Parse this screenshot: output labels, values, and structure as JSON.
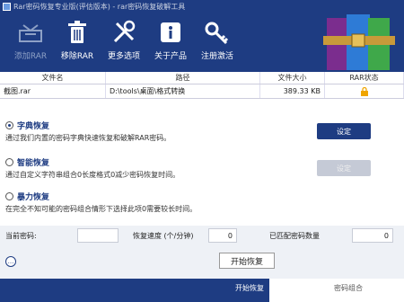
{
  "window": {
    "title": "Rar密码恢复专业版(评估版本) - rar密码恢复破解工具"
  },
  "toolbar": {
    "buttons": [
      {
        "label": "添加RAR",
        "icon": "add-archive-icon",
        "disabled": true
      },
      {
        "label": "移除RAR",
        "icon": "trash-icon"
      },
      {
        "label": "更多选项",
        "icon": "tools-icon"
      },
      {
        "label": "关于产品",
        "icon": "info-icon"
      },
      {
        "label": "注册激活",
        "icon": "key-icon"
      }
    ]
  },
  "table": {
    "headers": [
      "文件名",
      "路径",
      "文件大小",
      "RAR状态"
    ],
    "rows": [
      {
        "name": "截图.rar",
        "path": "D:\\tools\\桌面\\格式转换",
        "size": "389.33 KB",
        "status_icon": "lock-icon"
      }
    ]
  },
  "options": [
    {
      "label": "字典恢复",
      "desc": "通过我们内置的密码字典快速恢复和破解RAR密码。",
      "selected": true,
      "button": "设定",
      "button_enabled": true
    },
    {
      "label": "智能恢复",
      "desc": "通过自定义字符串组合0长度格式0减少密码恢复时间。",
      "selected": false,
      "button": "设定",
      "button_enabled": false
    },
    {
      "label": "暴力恢复",
      "desc": "在完全不知可能的密码组合情形下选择此项0需要较长时间。",
      "selected": false
    }
  ],
  "status": {
    "current_label": "当前密码:",
    "current_value": "",
    "speed_label": "恢复速度 (个/分钟)",
    "speed_value": "0",
    "count_label": "已匹配密码数量",
    "count_value": "0"
  },
  "actions": {
    "more": "...",
    "start_label": "开始恢复"
  },
  "footer": {
    "left": "开始恢复",
    "right": "密码组合"
  },
  "colors": {
    "brand": "#1e3c82",
    "accent": "#f0a500"
  }
}
